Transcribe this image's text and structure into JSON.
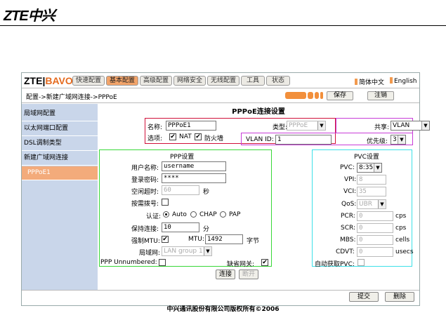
{
  "header": {
    "logo": "ZTE中兴"
  },
  "app": {
    "brand_left": "ZTE",
    "brand_sep": "|",
    "brand_right": "BAVO",
    "tabs": [
      "快速配置",
      "基本配置",
      "高级配置",
      "网络安全",
      "无线配置",
      "工具",
      "状态"
    ],
    "active_tab": "基本配置",
    "lang_cn": "简体中文",
    "lang_en": "English"
  },
  "breadcrumb": "配置->新建广域网连接->PPPoE",
  "toolbar": {
    "save_label": "保存",
    "logout_label": "注销"
  },
  "sidebar": {
    "items": [
      {
        "label": "局域网配置"
      },
      {
        "label": "以太网端口配置"
      },
      {
        "label": "DSL调制类型"
      },
      {
        "label": "新建广域网连接"
      },
      {
        "label": "PPPoE1"
      }
    ]
  },
  "form": {
    "title": "PPPoE连接设置",
    "name_label": "名称:",
    "name_value": "PPPoE1",
    "type_label": "类型:",
    "type_value": "PPPoE",
    "options_label": "选项:",
    "nat_label": "NAT",
    "firewall_label": "防火墙",
    "share_label": "共享:",
    "share_value": "VLAN",
    "vlan_id_label": "VLAN ID:",
    "vlan_id_value": "1",
    "priority_label": "优先级:",
    "priority_value": "3"
  },
  "ppp": {
    "title": "PPP设置",
    "username_label": "用户名称:",
    "username_value": "username",
    "password_label": "登录密码:",
    "password_value": "****",
    "idle_label": "空闲超时:",
    "idle_value": "60",
    "idle_unit": "秒",
    "ondemand_label": "按需拨号:",
    "auth_label": "认证:",
    "auth_options": [
      "Auto",
      "CHAP",
      "PAP"
    ],
    "keepalive_label": "保持连接:",
    "keepalive_value": "10",
    "keepalive_unit": "分",
    "force_mtu_label": "强制MTU:",
    "mtu_label": "MTU:",
    "mtu_value": "1492",
    "mtu_unit": "字节",
    "lan_label": "局域网:",
    "lan_value": "LAN group 1",
    "unnumbered_label": "PPP Unnumbered:",
    "default_gw_label": "缺省网关:"
  },
  "pvc": {
    "title": "PVC设置",
    "pvc_label": "PVC:",
    "pvc_value": "8:35",
    "vpi_label": "VPI:",
    "vpi_value": "8",
    "vci_label": "VCI:",
    "vci_value": "35",
    "qos_label": "QoS:",
    "qos_value": "UBR",
    "pcr_label": "PCR:",
    "pcr_unit": "cps",
    "scr_label": "SCR:",
    "scr_unit": "cps",
    "mbs_label": "MBS:",
    "mbs_unit": "cells",
    "cdvt_label": "CDVT:",
    "cdvt_unit": "usecs",
    "pcr_value": "0",
    "scr_value": "0",
    "mbs_value": "0",
    "cdvt_value": "0",
    "auto_pvc_label": "自动获取PVC:"
  },
  "actions": {
    "connect_label": "连接",
    "disconnect_label": "断开",
    "submit_label": "提交",
    "delete_label": "删除"
  },
  "copyright": "中兴通讯股份有限公司版权所有©2006",
  "colors": {
    "accent_orange": "#f28f3b",
    "sidebar_bg": "#c9d6ea",
    "red_box": "#d0103a",
    "magenta_box": "#c83cd8",
    "green_box": "#38d838",
    "cyan_box": "#3ce0e8"
  }
}
